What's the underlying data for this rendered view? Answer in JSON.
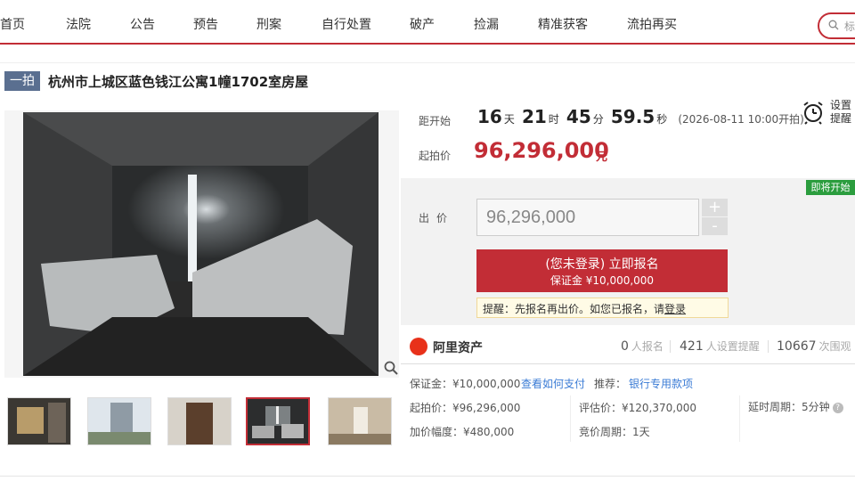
{
  "nav": {
    "items": [
      "首页",
      "法院",
      "公告",
      "预告",
      "刑案",
      "自行处置",
      "破产",
      "捡漏",
      "精准获客",
      "流拍再买"
    ],
    "search_placeholder": "标"
  },
  "title": {
    "tag": "一拍",
    "text": "杭州市上城区蓝色钱江公寓1幢1702室房屋"
  },
  "countdown": {
    "label": "距开始",
    "days": "16",
    "days_unit": "天",
    "hours": "21",
    "hours_unit": "时",
    "minutes": "45",
    "minutes_unit": "分",
    "seconds": "59.5",
    "seconds_unit": "秒",
    "start_time": "(2026-08-11 10:00开拍)"
  },
  "remind": {
    "line1": "设置",
    "line2": "提醒"
  },
  "price": {
    "label": "起拍价",
    "value": "96,296,000",
    "unit": "元"
  },
  "bid": {
    "badge": "即将开始",
    "label": "出价",
    "input_value": "96,296,000",
    "plus": "+",
    "minus": "-",
    "button_main": "(您未登录) 立即报名",
    "button_sub": "保证金 ¥10,000,000",
    "tip_prefix": "提醒：先报名再出价。如您已报名，请",
    "tip_link": "登录"
  },
  "stats": {
    "brand": "阿里资产",
    "signup_count": "0",
    "signup_label": "人报名",
    "remind_count": "421",
    "remind_label": "人设置提醒",
    "view_count": "10667",
    "view_label": "次围观"
  },
  "info": {
    "deposit_label": "保证金：",
    "deposit_value": "¥10,000,000",
    "how_pay": "查看如何支付",
    "recommend_label": "推荐：",
    "recommend_value": "银行专用款项",
    "start_label": "起拍价：",
    "start_value": "¥96,296,000",
    "eval_label": "评估价：",
    "eval_value": "¥120,370,000",
    "delay_label": "延时周期：",
    "delay_value": "5分钟",
    "step_label": "加价幅度：",
    "step_value": "¥480,000",
    "period_label": "竞价周期：",
    "period_value": "1天"
  },
  "colors": {
    "brand_red": "#c22d36",
    "badge_green": "#2b9d3e",
    "tag_blue": "#5a6f90",
    "link_blue": "#3a7bd5"
  }
}
